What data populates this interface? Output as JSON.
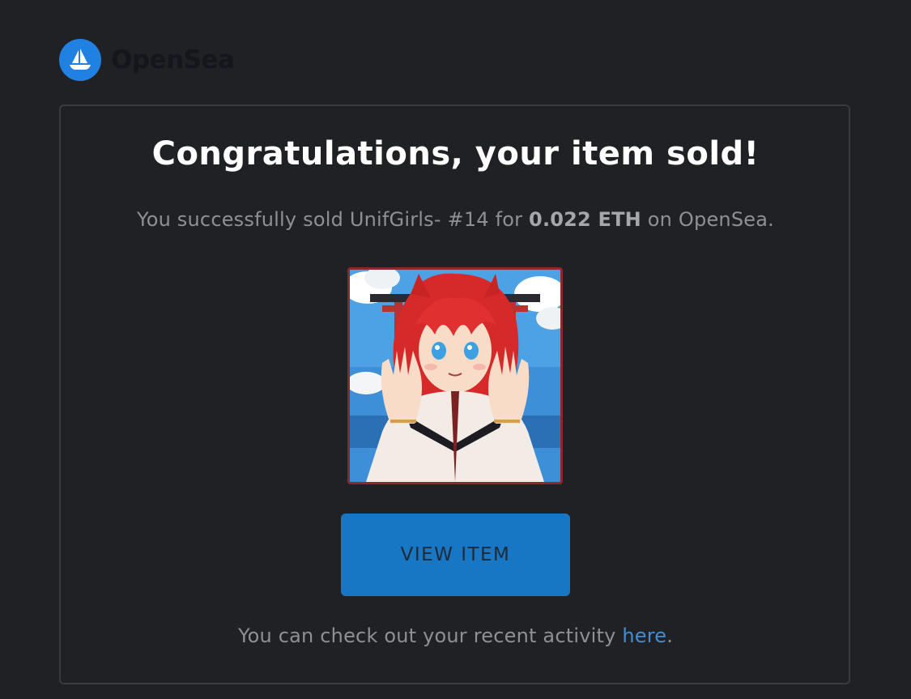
{
  "brand": {
    "name": "OpenSea",
    "logo_icon": "sailboat-icon",
    "logo_color": "#2081e2"
  },
  "email": {
    "title": "Congratulations, your item sold!",
    "subtitle": {
      "prefix": "You successfully sold UnifGirls- #14 for ",
      "price": "0.022 ETH",
      "suffix": " on OpenSea."
    },
    "item_image": {
      "icon": "nft-artwork-image",
      "frame_color": "#8a2a2a"
    },
    "view_button_label": "VIEW ITEM",
    "button_color": "#1877c5",
    "footer": {
      "prefix": "You can check out your recent activity ",
      "link_label": "here",
      "suffix": "."
    },
    "link_color": "#3e8fd8"
  }
}
